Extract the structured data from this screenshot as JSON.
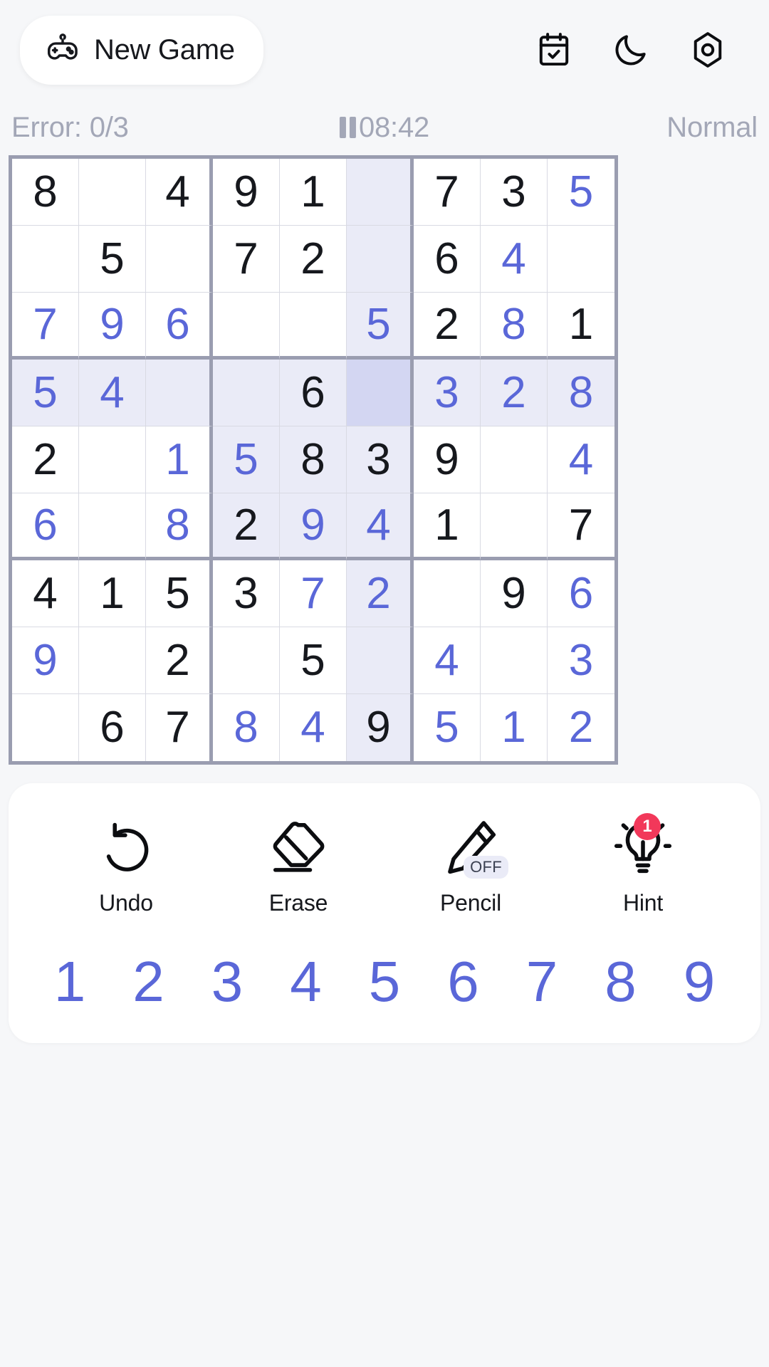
{
  "header": {
    "new_game_label": "New Game",
    "new_game_icon": "gamepad-icon",
    "icons": [
      {
        "name": "calendar-check-icon",
        "label": "Daily Challenge"
      },
      {
        "name": "moon-icon",
        "label": "Dark Mode"
      },
      {
        "name": "gear-icon",
        "label": "Settings"
      }
    ]
  },
  "status": {
    "error_label": "Error: 0/3",
    "errors_current": 0,
    "errors_max": 3,
    "timer": "08:42",
    "pause_icon": "pause-icon",
    "difficulty": "Normal"
  },
  "board": {
    "selected": {
      "row": 3,
      "col": 5
    },
    "colors": {
      "given": "#16181d",
      "user": "#5a67d8",
      "highlight": "#eaebf7",
      "selected": "#d3d6f2",
      "grid_line": "#d9dae3",
      "grid_bold": "#9a9db0"
    },
    "rows": [
      [
        {
          "v": "8",
          "t": "given"
        },
        {
          "v": "",
          "t": "empty"
        },
        {
          "v": "4",
          "t": "given"
        },
        {
          "v": "9",
          "t": "given"
        },
        {
          "v": "1",
          "t": "given"
        },
        {
          "v": "",
          "t": "empty",
          "hl": true
        },
        {
          "v": "7",
          "t": "given"
        },
        {
          "v": "3",
          "t": "given"
        },
        {
          "v": "5",
          "t": "user"
        }
      ],
      [
        {
          "v": "",
          "t": "empty"
        },
        {
          "v": "5",
          "t": "given"
        },
        {
          "v": "",
          "t": "empty"
        },
        {
          "v": "7",
          "t": "given"
        },
        {
          "v": "2",
          "t": "given"
        },
        {
          "v": "",
          "t": "empty",
          "hl": true
        },
        {
          "v": "6",
          "t": "given"
        },
        {
          "v": "4",
          "t": "user"
        },
        {
          "v": "",
          "t": "empty"
        }
      ],
      [
        {
          "v": "7",
          "t": "user"
        },
        {
          "v": "9",
          "t": "user"
        },
        {
          "v": "6",
          "t": "user"
        },
        {
          "v": "",
          "t": "empty"
        },
        {
          "v": "",
          "t": "empty"
        },
        {
          "v": "5",
          "t": "user",
          "hl": true
        },
        {
          "v": "2",
          "t": "given"
        },
        {
          "v": "8",
          "t": "user"
        },
        {
          "v": "1",
          "t": "given"
        }
      ],
      [
        {
          "v": "5",
          "t": "user",
          "hl": true
        },
        {
          "v": "4",
          "t": "user",
          "hl": true
        },
        {
          "v": "",
          "t": "empty",
          "hl": true
        },
        {
          "v": "",
          "t": "empty",
          "hl": true
        },
        {
          "v": "6",
          "t": "given",
          "hl": true
        },
        {
          "v": "",
          "t": "empty",
          "sel": true
        },
        {
          "v": "3",
          "t": "user",
          "hl": true
        },
        {
          "v": "2",
          "t": "user",
          "hl": true
        },
        {
          "v": "8",
          "t": "user",
          "hl": true
        }
      ],
      [
        {
          "v": "2",
          "t": "given"
        },
        {
          "v": "",
          "t": "empty"
        },
        {
          "v": "1",
          "t": "user"
        },
        {
          "v": "5",
          "t": "user",
          "hl": true
        },
        {
          "v": "8",
          "t": "given",
          "hl": true
        },
        {
          "v": "3",
          "t": "given",
          "hl": true
        },
        {
          "v": "9",
          "t": "given"
        },
        {
          "v": "",
          "t": "empty"
        },
        {
          "v": "4",
          "t": "user"
        }
      ],
      [
        {
          "v": "6",
          "t": "user"
        },
        {
          "v": "",
          "t": "empty"
        },
        {
          "v": "8",
          "t": "user"
        },
        {
          "v": "2",
          "t": "given",
          "hl": true
        },
        {
          "v": "9",
          "t": "user",
          "hl": true
        },
        {
          "v": "4",
          "t": "user",
          "hl": true
        },
        {
          "v": "1",
          "t": "given"
        },
        {
          "v": "",
          "t": "empty"
        },
        {
          "v": "7",
          "t": "given"
        }
      ],
      [
        {
          "v": "4",
          "t": "given"
        },
        {
          "v": "1",
          "t": "given"
        },
        {
          "v": "5",
          "t": "given"
        },
        {
          "v": "3",
          "t": "given"
        },
        {
          "v": "7",
          "t": "user"
        },
        {
          "v": "2",
          "t": "user",
          "hl": true
        },
        {
          "v": "",
          "t": "empty"
        },
        {
          "v": "9",
          "t": "given"
        },
        {
          "v": "6",
          "t": "user"
        }
      ],
      [
        {
          "v": "9",
          "t": "user"
        },
        {
          "v": "",
          "t": "empty"
        },
        {
          "v": "2",
          "t": "given"
        },
        {
          "v": "",
          "t": "empty"
        },
        {
          "v": "5",
          "t": "given"
        },
        {
          "v": "",
          "t": "empty",
          "hl": true
        },
        {
          "v": "4",
          "t": "user"
        },
        {
          "v": "",
          "t": "empty"
        },
        {
          "v": "3",
          "t": "user"
        }
      ],
      [
        {
          "v": "",
          "t": "empty"
        },
        {
          "v": "6",
          "t": "given"
        },
        {
          "v": "7",
          "t": "given"
        },
        {
          "v": "8",
          "t": "user"
        },
        {
          "v": "4",
          "t": "user"
        },
        {
          "v": "9",
          "t": "given",
          "hl": true
        },
        {
          "v": "5",
          "t": "user"
        },
        {
          "v": "1",
          "t": "user"
        },
        {
          "v": "2",
          "t": "user"
        }
      ]
    ]
  },
  "tools": [
    {
      "name": "undo-button",
      "label": "Undo",
      "icon": "undo-icon"
    },
    {
      "name": "erase-button",
      "label": "Erase",
      "icon": "eraser-icon"
    },
    {
      "name": "pencil-button",
      "label": "Pencil",
      "icon": "pencil-icon",
      "badge": "OFF"
    },
    {
      "name": "hint-button",
      "label": "Hint",
      "icon": "lightbulb-icon",
      "count": "1"
    }
  ],
  "numpad": [
    "1",
    "2",
    "3",
    "4",
    "5",
    "6",
    "7",
    "8",
    "9"
  ]
}
